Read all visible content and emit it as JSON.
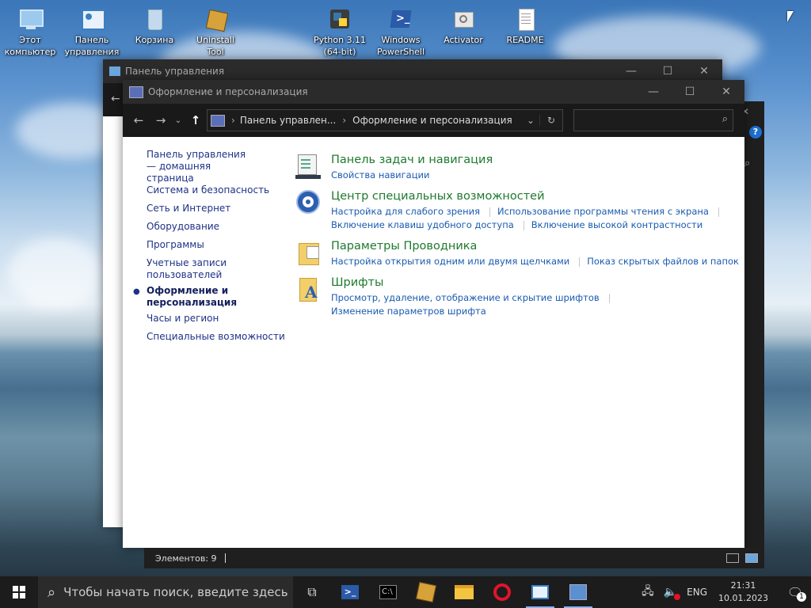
{
  "desktop": {
    "icons": [
      {
        "label": "Этот компьютер"
      },
      {
        "label": "Панель управления"
      },
      {
        "label": "Корзина"
      },
      {
        "label": "Uninstall Tool"
      },
      {
        "label": "Python 3.11 (64-bit)"
      },
      {
        "label": "Windows PowerShell"
      },
      {
        "label": "Activator"
      },
      {
        "label": "README"
      }
    ]
  },
  "back_window": {
    "title": "Панель управления"
  },
  "front_window": {
    "title": "Оформление и персонализация",
    "address": {
      "crumb1": "Панель управлен...",
      "crumb2": "Оформление и персонализация"
    },
    "search_placeholder": "",
    "left_nav": {
      "home": "Панель управления — домашняя страница",
      "items": [
        "Система и безопасность",
        "Сеть и Интернет",
        "Оборудование",
        "Программы",
        "Учетные записи пользователей",
        "Оформление и персонализация",
        "Часы и регион",
        "Специальные возможности"
      ],
      "selected_index": 5
    },
    "categories": [
      {
        "title": "Панель задач и навигация",
        "icon": "taskbar-icon",
        "links": [
          [
            "Свойства навигации"
          ]
        ]
      },
      {
        "title": "Центр специальных возможностей",
        "icon": "ease-of-access-icon",
        "links": [
          [
            "Настройка для слабого зрения",
            "Использование программы чтения с экрана"
          ],
          [
            "Включение клавиш удобного доступа",
            "Включение высокой контрастности"
          ]
        ]
      },
      {
        "title": "Параметры Проводника",
        "icon": "folder-options-icon",
        "links": [
          [
            "Настройка открытия одним или двумя щелчками",
            "Показ скрытых файлов и папок"
          ]
        ]
      },
      {
        "title": "Шрифты",
        "icon": "fonts-icon",
        "links": [
          [
            "Просмотр, удаление, отображение и скрытие шрифтов"
          ],
          [
            "Изменение параметров шрифта"
          ]
        ]
      }
    ],
    "status": "Элементов: 9"
  },
  "taskbar": {
    "search_placeholder": "Чтобы начать поиск, введите здесь",
    "lang": "ENG",
    "time": "21:31",
    "date": "10.01.2023",
    "notifications": "1"
  },
  "colors": {
    "link": "#1a5bb0",
    "category_title": "#1e7a2e",
    "nav": "#1e3287",
    "titlebar": "#2b2b2b"
  }
}
